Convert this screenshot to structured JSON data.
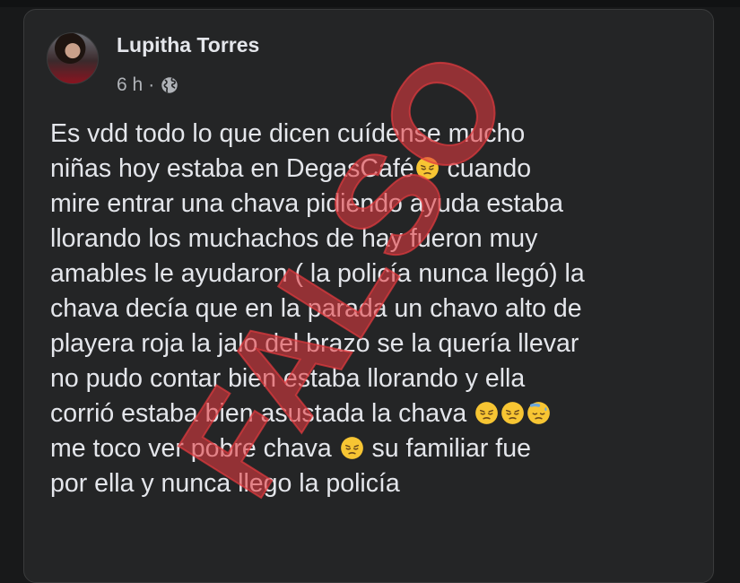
{
  "post": {
    "author": "Lupitha Torres",
    "timestamp": "6 h",
    "separator": "·",
    "visibility_icon": "globe-icon",
    "avatar_icon": "profile-photo",
    "text_lines": [
      [
        "Es vdd todo lo que dicen cuídense mucho"
      ],
      [
        "niñas hoy estaba en DegasCafé",
        "[emoji]",
        " cuando"
      ],
      [
        "mire entrar una chava pidiendo ayuda estaba"
      ],
      [
        "llorando los muchachos de hay fueron muy"
      ],
      [
        "amables le ayudaron ( la policía nunca llegó) la"
      ],
      [
        "chava decía que en la parada un chavo alto de"
      ],
      [
        "playera roja la jalo del brazo se la quería llevar"
      ],
      [
        "no pudo contar bien estaba llorando y ella"
      ],
      [
        "corrió estaba bien asustada la chava "
      ],
      [
        "me toco ver pobre chava ",
        " su  familiar  fue"
      ],
      [
        "por ella y nunca llego la policía"
      ]
    ],
    "line1": "Es vdd todo lo que dicen cuídense mucho",
    "line2a": "niñas hoy estaba en DegasCafé",
    "line2b": " cuando",
    "line3": "mire entrar una chava pidiendo ayuda estaba",
    "line4": "llorando los muchachos de hay fueron muy",
    "line5": "amables le ayudaron ( la policía nunca llegó) la",
    "line6": "chava decía que en la parada un chavo alto de",
    "line7": "playera roja la jalo del brazo se la quería llevar",
    "line8": "no pudo contar bien estaba llorando y ella",
    "line9": "corrió estaba bien asustada la chava ",
    "line10a": "me toco ver pobre chava ",
    "line10b": " su  familiar  fue",
    "line11": "por ella y nunca llego la policía",
    "emojis": [
      "pensive-face-emoji",
      "pensive-face-emoji",
      "pensive-face-emoji",
      "sweat-face-emoji",
      "pensive-face-emoji"
    ]
  },
  "stamp": {
    "text": "FALSO",
    "color": "#e33a3f"
  },
  "colors": {
    "background": "#18191a",
    "card": "#242526",
    "text": "#e4e6eb",
    "muted": "#b0b3b8"
  }
}
